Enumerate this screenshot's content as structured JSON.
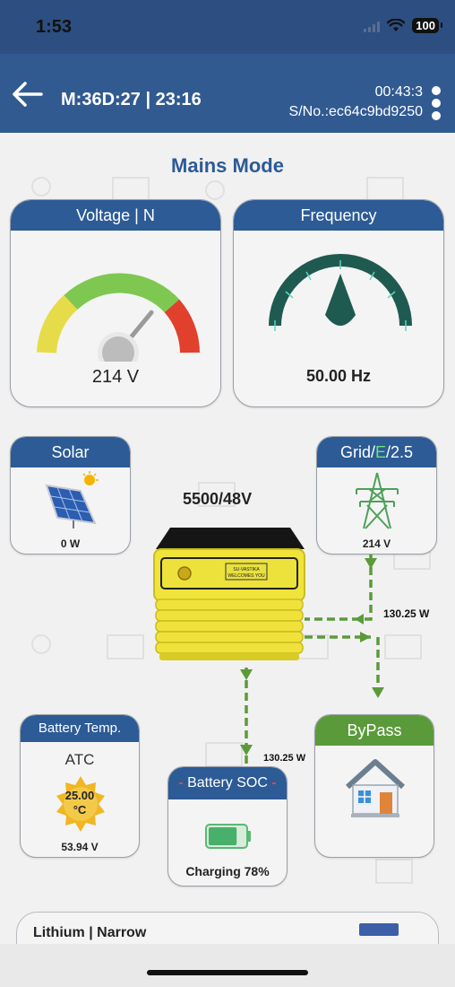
{
  "status": {
    "time": "1:53",
    "battery": "100"
  },
  "header": {
    "title": "M:36D:27 | 23:16",
    "clock": "00:43:3",
    "serial": "S/No.:ec64c9bd9250"
  },
  "mode": "Mains Mode",
  "voltage_card": {
    "title": "Voltage | N",
    "value": "214 V",
    "needle_fraction": 0.72
  },
  "frequency_card": {
    "title": "Frequency",
    "value": "50.00 Hz"
  },
  "solar_card": {
    "title": "Solar",
    "value": "0 W"
  },
  "grid_card": {
    "title_prefix": "Grid/",
    "title_accent": "E",
    "title_suffix": "/2.5",
    "value": "214 V"
  },
  "inverter": {
    "rating": "5500/48V",
    "display_line1": "SU-VASTIKA",
    "display_line2": "WELCOMES YOU"
  },
  "flows": {
    "grid_to_inverter": "130.25 W",
    "inverter_to_battery": "130.25 W"
  },
  "battery_temp_card": {
    "title": "Battery Temp.",
    "mode": "ATC",
    "temp_value": "25.00",
    "temp_unit": "°C",
    "voltage": "53.94 V"
  },
  "battery_soc_card": {
    "title": "Battery SOC",
    "status": "Charging 78%",
    "soc_fraction": 0.78
  },
  "bypass_card": {
    "title": "ByPass"
  },
  "bottom_card": {
    "label": "Lithium | Narrow"
  },
  "colors": {
    "brand_blue": "#2c5b96",
    "flow_green": "#5b9a3a",
    "status_bar": "#2d4e80"
  },
  "icons": [
    "back-arrow-icon",
    "kebab-menu-icon",
    "solar-panel-icon",
    "transmission-tower-icon",
    "house-icon",
    "battery-icon",
    "sun-badge-icon"
  ]
}
